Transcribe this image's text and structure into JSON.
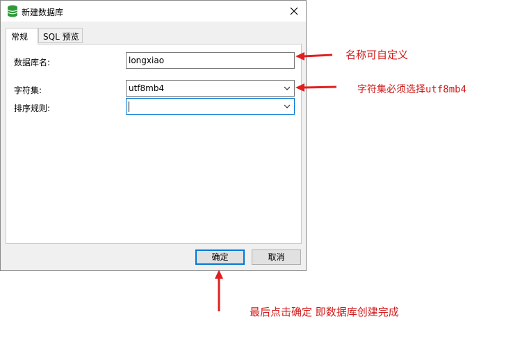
{
  "window": {
    "title": "新建数据库",
    "icon": "database-icon",
    "close_icon": "close-icon"
  },
  "tabs": [
    {
      "label": "常规",
      "active": true
    },
    {
      "label": "SQL 预览",
      "active": false
    }
  ],
  "form": {
    "name_label": "数据库名:",
    "name_value": "longxiao",
    "charset_label": "字符集:",
    "charset_value": "utf8mb4",
    "collation_label": "排序规则:",
    "collation_value": ""
  },
  "buttons": {
    "ok": "确定",
    "cancel": "取消"
  },
  "annotations": {
    "name_note": "名称可自定义",
    "charset_note": "字符集必须选择utf8mb4",
    "ok_note": "最后点击确定 即数据库创建完成",
    "arrow_color": "#e02020"
  }
}
